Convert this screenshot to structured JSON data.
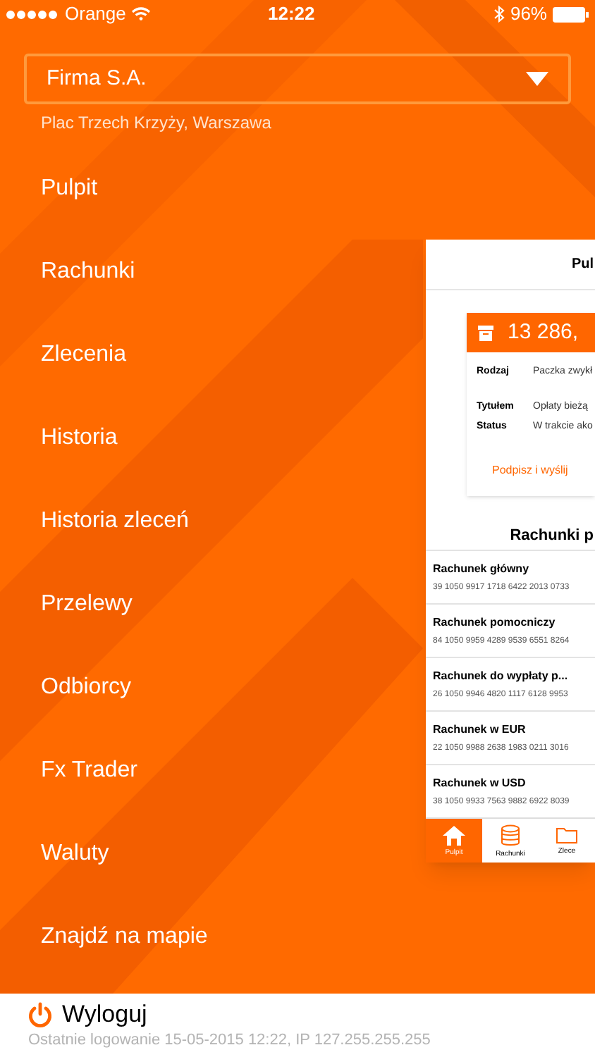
{
  "status_bar": {
    "carrier": "Orange",
    "time": "12:22",
    "battery": "96%"
  },
  "company_selector": {
    "value": "Firma S.A.",
    "address": "Plac Trzech Krzyży, Warszawa"
  },
  "menu": {
    "items": [
      "Pulpit",
      "Rachunki",
      "Zlecenia",
      "Historia",
      "Historia zleceń",
      "Przelewy",
      "Odbiorcy",
      "Fx Trader",
      "Waluty",
      "Znajdź na mapie"
    ]
  },
  "preview": {
    "title": "Pul",
    "order": {
      "amount": "13 286,",
      "rows": [
        {
          "label": "Rodzaj",
          "value": "Paczka zwykł"
        },
        {
          "label": "Tytułem",
          "value": "Opłaty bieżą"
        },
        {
          "label": "Status",
          "value": "W trakcie ako"
        }
      ],
      "action": "Podpisz i wyślij"
    },
    "accounts_title": "Rachunki p",
    "accounts": [
      {
        "name": "Rachunek główny",
        "number": "39 1050 9917 1718 6422 2013 0733"
      },
      {
        "name": "Rachunek pomocniczy",
        "number": "84 1050 9959 4289 9539 6551 8264"
      },
      {
        "name": "Rachunek do wypłaty p...",
        "number": "26 1050 9946 4820 1117 6128 9953"
      },
      {
        "name": "Rachunek w EUR",
        "number": "22 1050 9988 2638 1983 0211 3016"
      },
      {
        "name": "Rachunek w USD",
        "number": "38 1050 9933 7563 9882 6922 8039"
      }
    ],
    "tabs": [
      {
        "label": "Pulpit",
        "selected": true,
        "kind": "home"
      },
      {
        "label": "Rachunki",
        "selected": false,
        "kind": "coins"
      },
      {
        "label": "Zlece",
        "selected": false,
        "kind": "folder"
      }
    ]
  },
  "footer": {
    "logout": "Wyloguj",
    "last_login": "Ostatnie logowanie 15-05-2015 12:22, IP 127.255.255.255"
  }
}
